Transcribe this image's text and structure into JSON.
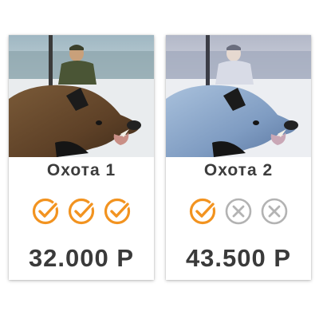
{
  "cards": [
    {
      "title": "Охота 1",
      "price": "32.000 Р",
      "features": [
        "check-icon",
        "check-icon",
        "check-icon"
      ],
      "photo_tint": "natural"
    },
    {
      "title": "Охота 2",
      "price": "43.500 Р",
      "features": [
        "check-icon",
        "cross-icon",
        "cross-icon"
      ],
      "photo_tint": "blue"
    }
  ],
  "colors": {
    "accent_orange": "#f29320",
    "disabled_gray": "#b3b3b3",
    "text_dark": "#3c3c3c"
  }
}
